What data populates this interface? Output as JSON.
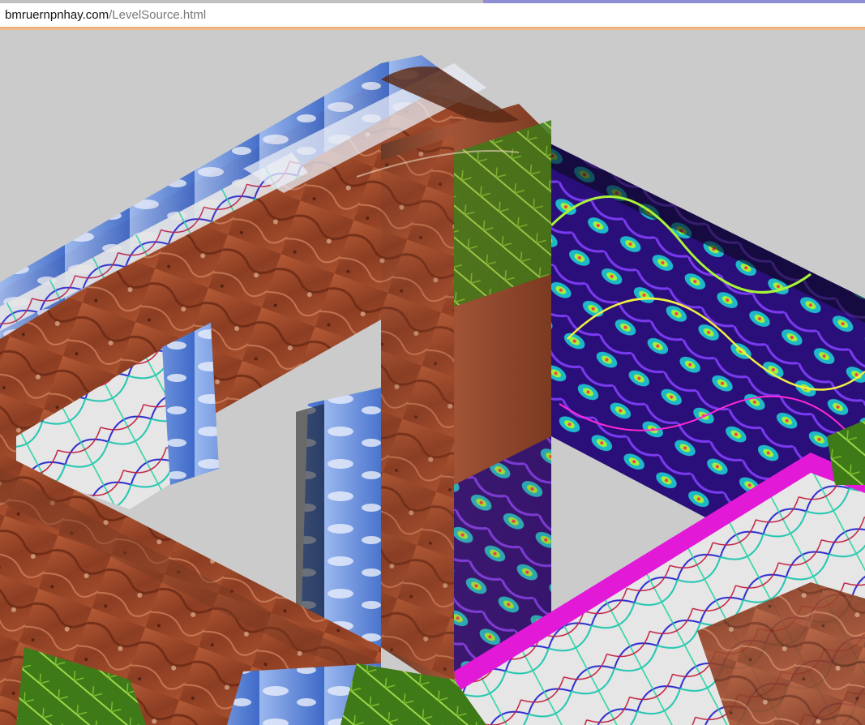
{
  "browser": {
    "url_host": "bmruernpnhay.com",
    "url_path": "/LevelSource.html"
  },
  "viewport": {
    "background_color": "#cbcbcb",
    "scene": "textured-3d-square-frame"
  },
  "colors": {
    "rock": "#9a4a2c",
    "rock_dark": "#6e2c18",
    "rock_light": "#c06a45",
    "sky_blue": "#5d86d8",
    "neon_cyan": "#2ee0d2",
    "neon_purple": "#6a1fd0",
    "neon_green": "#9af23a",
    "magenta": "#e21ad8",
    "fern_green": "#4a8a1e",
    "lattice_white": "#e9e9ea"
  }
}
